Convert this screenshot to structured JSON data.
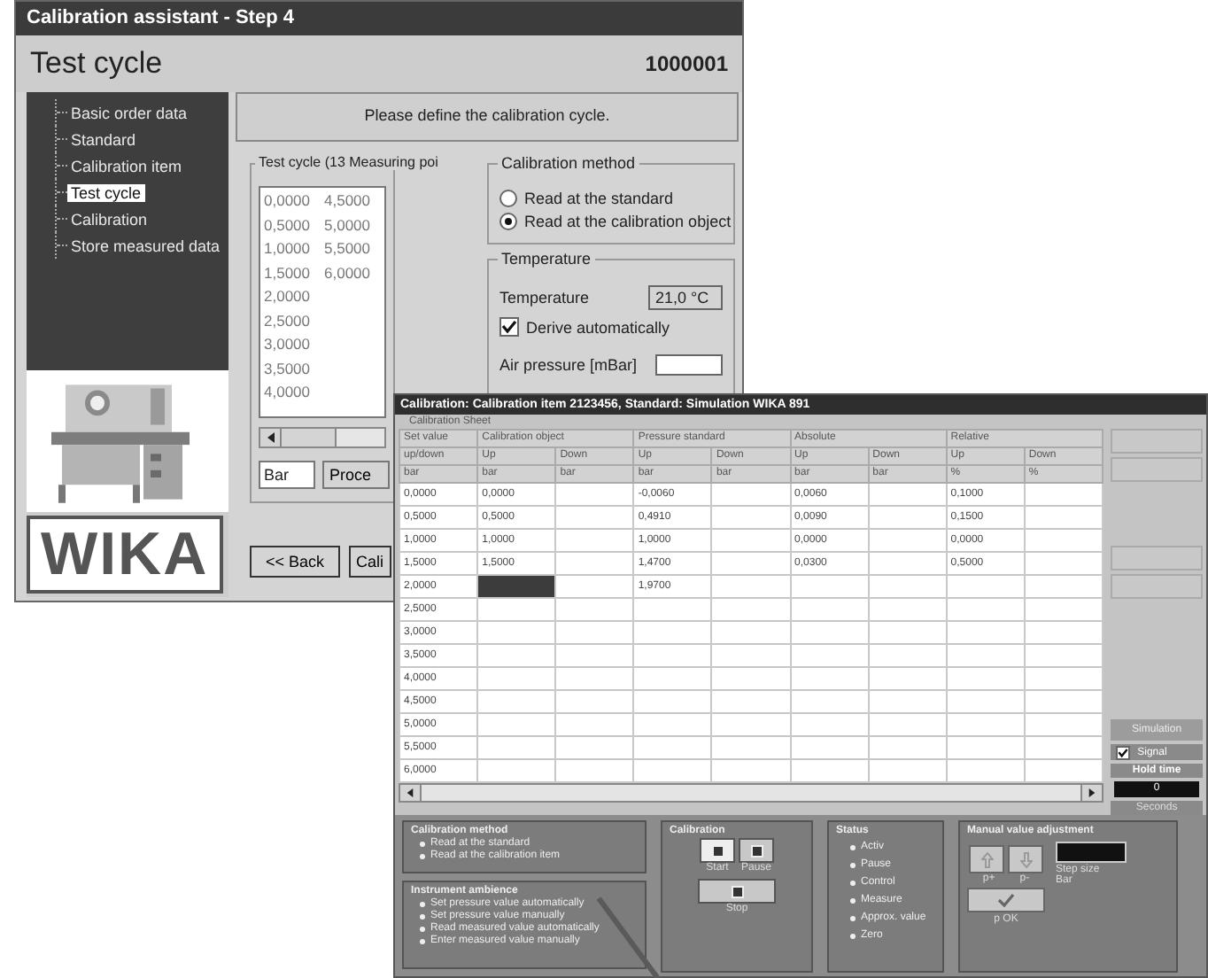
{
  "back_window": {
    "title": "Calibration assistant - Step 4",
    "header": {
      "title": "Test cycle",
      "number": "1000001"
    },
    "tree": [
      {
        "label": "Basic order data",
        "selected": false
      },
      {
        "label": "Standard",
        "selected": false
      },
      {
        "label": "Calibration item",
        "selected": false
      },
      {
        "label": "Test cycle",
        "selected": true
      },
      {
        "label": "Calibration",
        "selected": false
      },
      {
        "label": "Store measured data",
        "selected": false
      }
    ],
    "logo": "WIKA",
    "prompt": "Please define the calibration cycle.",
    "test_cycle": {
      "title": "Test cycle (13 Measuring poi",
      "values": [
        "0,0000",
        "0,5000",
        "1,0000",
        "1,5000",
        "2,0000",
        "2,5000",
        "3,0000",
        "3,5000",
        "4,0000",
        "4,5000",
        "5,0000",
        "5,5000",
        "6,0000"
      ],
      "unit": "Bar",
      "proceed_button": "Proce"
    },
    "calibration_method": {
      "title": "Calibration method",
      "options": [
        {
          "label": "Read at the standard",
          "selected": false
        },
        {
          "label": "Read at the calibration object",
          "selected": true
        }
      ]
    },
    "temperature": {
      "title": "Temperature",
      "label": "Temperature",
      "value": "21,0 °C",
      "derive": {
        "label": "Derive automatically",
        "checked": true
      },
      "air_pressure_label": "Air pressure [mBar]"
    },
    "buttons": [
      "<< Back",
      "Cali"
    ]
  },
  "front_window": {
    "title": "Calibration: Calibration item 2123456, Standard: Simulation WIKA 891",
    "sheet_label": "Calibration Sheet",
    "header": [
      {
        "label": "Set value",
        "subheads": [
          {
            "label": "up/down",
            "unit": "bar"
          }
        ]
      },
      {
        "label": "Calibration object",
        "subheads": [
          {
            "label": "Up",
            "unit": "bar"
          },
          {
            "label": "Down",
            "unit": "bar"
          }
        ]
      },
      {
        "label": "Pressure standard",
        "subheads": [
          {
            "label": "Up",
            "unit": "bar"
          },
          {
            "label": "Down",
            "unit": "bar"
          }
        ]
      },
      {
        "label": "Absolute",
        "subheads": [
          {
            "label": "Up",
            "unit": "bar"
          },
          {
            "label": "Down",
            "unit": "bar"
          }
        ]
      },
      {
        "label": "Relative",
        "subheads": [
          {
            "label": "Up",
            "unit": "%"
          },
          {
            "label": "Down",
            "unit": "%"
          }
        ]
      }
    ],
    "rows": [
      {
        "set_value": "0,0000",
        "calibration_up": "0,0000",
        "pressure_up": "-0,0060",
        "absolute_up": "0,0060",
        "relative_up": "0,1000",
        "selected": false
      },
      {
        "set_value": "0,5000",
        "calibration_up": "0,5000",
        "pressure_up": "0,4910",
        "absolute_up": "0,0090",
        "relative_up": "0,1500",
        "selected": false
      },
      {
        "set_value": "1,0000",
        "calibration_up": "1,0000",
        "pressure_up": "1,0000",
        "absolute_up": "0,0000",
        "relative_up": "0,0000",
        "selected": false
      },
      {
        "set_value": "1,5000",
        "calibration_up": "1,5000",
        "pressure_up": "1,4700",
        "absolute_up": "0,0300",
        "relative_up": "0,5000",
        "selected": false
      },
      {
        "set_value": "2,0000",
        "pressure_up": "1,9700",
        "selected": true
      },
      {
        "set_value": "2,5000",
        "selected": false
      },
      {
        "set_value": "3,0000",
        "selected": false
      },
      {
        "set_value": "3,5000",
        "selected": false
      },
      {
        "set_value": "4,0000",
        "selected": false
      },
      {
        "set_value": "4,5000",
        "selected": false
      },
      {
        "set_value": "5,0000",
        "selected": false
      },
      {
        "set_value": "5,5000",
        "selected": false
      },
      {
        "set_value": "6,0000",
        "selected": false
      }
    ],
    "side_buttons": [
      {
        "disabled": true
      },
      {
        "disabled": true
      },
      {
        "disabled": true
      },
      {
        "disabled": true
      }
    ],
    "simulation": "Simulation",
    "signal": {
      "label": "Signal",
      "checked": true
    },
    "hold_time": {
      "label": "Hold time",
      "value": "0",
      "unit": "Seconds"
    },
    "calibration_method": {
      "title": "Calibration method",
      "items": [
        "Read at the standard",
        "Read at the calibration item"
      ]
    },
    "instrument_ambience": {
      "title": "Instrument ambience",
      "items": [
        "Set pressure value automatically",
        "Set pressure value manually",
        "Read measured value automatically",
        "Enter measured value manually"
      ]
    },
    "calibration": {
      "title": "Calibration",
      "start": "Start",
      "pause": "Pause",
      "stop": "Stop"
    },
    "status": {
      "title": "Status",
      "items": [
        "Activ",
        "Pause",
        "Control",
        "Measure",
        "Approx. value",
        "Zero"
      ]
    },
    "manual": {
      "title": "Manual value adjustment",
      "up_label": "p+",
      "down_label": "p-",
      "step_label": "Step size",
      "step_unit": "Bar",
      "ok_label": "p OK"
    }
  }
}
